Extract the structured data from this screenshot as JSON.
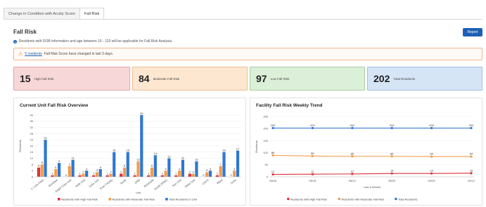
{
  "tabs": [
    {
      "label": "Change in Condition with Acuity Score"
    },
    {
      "label": "Fall Risk"
    }
  ],
  "page_title": "Fall Risk",
  "report_button": "Report",
  "info_text": "Residents with DOB information and age between 15 - 120 will be applicable for Fall Risk Analysis.",
  "alert": {
    "link": "5 residents",
    "text": "Fall Risk Score have changed in last 3 days."
  },
  "cards": [
    {
      "value": "15",
      "label": "High Fall Risk"
    },
    {
      "value": "84",
      "label": "Moderate Fall Risk"
    },
    {
      "value": "97",
      "label": "Low Fall Risk"
    },
    {
      "value": "202",
      "label": "Total Residents"
    }
  ],
  "colors": {
    "high": "#d9323a",
    "moderate": "#f39c4a",
    "total": "#2f77d1",
    "link": "#1d5fb7"
  },
  "chart_data": [
    {
      "type": "bar",
      "title": "Current Unit Fall Risk Overview",
      "xlabel": "Unit",
      "ylabel": "Residents",
      "ylim": [
        0,
        40
      ],
      "yticks": [
        0,
        4,
        8,
        12,
        16,
        20,
        24,
        28,
        32,
        36,
        40
      ],
      "categories": [
        "1 Lone Palm",
        "Buckeye",
        "Angel Care Unit",
        "Jade Unit",
        "Care Unit",
        "Ever Facility",
        "North",
        "ORB",
        "Riverside",
        "South (RNC)",
        "Sun Unit",
        "West Unit",
        "Unit A",
        "Ward",
        "Zone"
      ],
      "series": [
        {
          "name": "Residents with High Fall Risk",
          "values": [
            6,
            1,
            0,
            1,
            1,
            1,
            2,
            1,
            1,
            1,
            1,
            2,
            0,
            1,
            0
          ]
        },
        {
          "name": "Residents with Moderate Fall Risk",
          "values": [
            8,
            5,
            7,
            2,
            3,
            2,
            6,
            10,
            6,
            4,
            4,
            2,
            3,
            7,
            4
          ]
        },
        {
          "name": "Total Residents in Unit",
          "values": [
            24,
            9,
            11,
            4,
            5,
            16,
            16,
            40,
            14,
            12,
            11,
            10,
            4,
            16,
            17
          ]
        }
      ],
      "grid": true,
      "legend": "bottom"
    },
    {
      "type": "line",
      "title": "Facility Fall Risk Weekly Trend",
      "xlabel": "Last 6 Weeks",
      "ylabel": "Residents",
      "ylim": [
        0,
        250
      ],
      "yticks": [
        0,
        50,
        100,
        150,
        200,
        250
      ],
      "x": [
        "08/08",
        "08/15",
        "08/22",
        "08/29",
        "09/05",
        "09/12"
      ],
      "series": [
        {
          "name": "Residents with High Fall Risk",
          "values": [
            10,
            11,
            12,
            14,
            14,
            15
          ]
        },
        {
          "name": "Residents with Moderate Fall Risk",
          "values": [
            89,
            86,
            85,
            85,
            84,
            84
          ]
        },
        {
          "name": "Total Residents",
          "values": [
            202,
            202,
            202,
            202,
            202,
            202
          ]
        }
      ],
      "grid": true,
      "legend": "bottom"
    }
  ]
}
